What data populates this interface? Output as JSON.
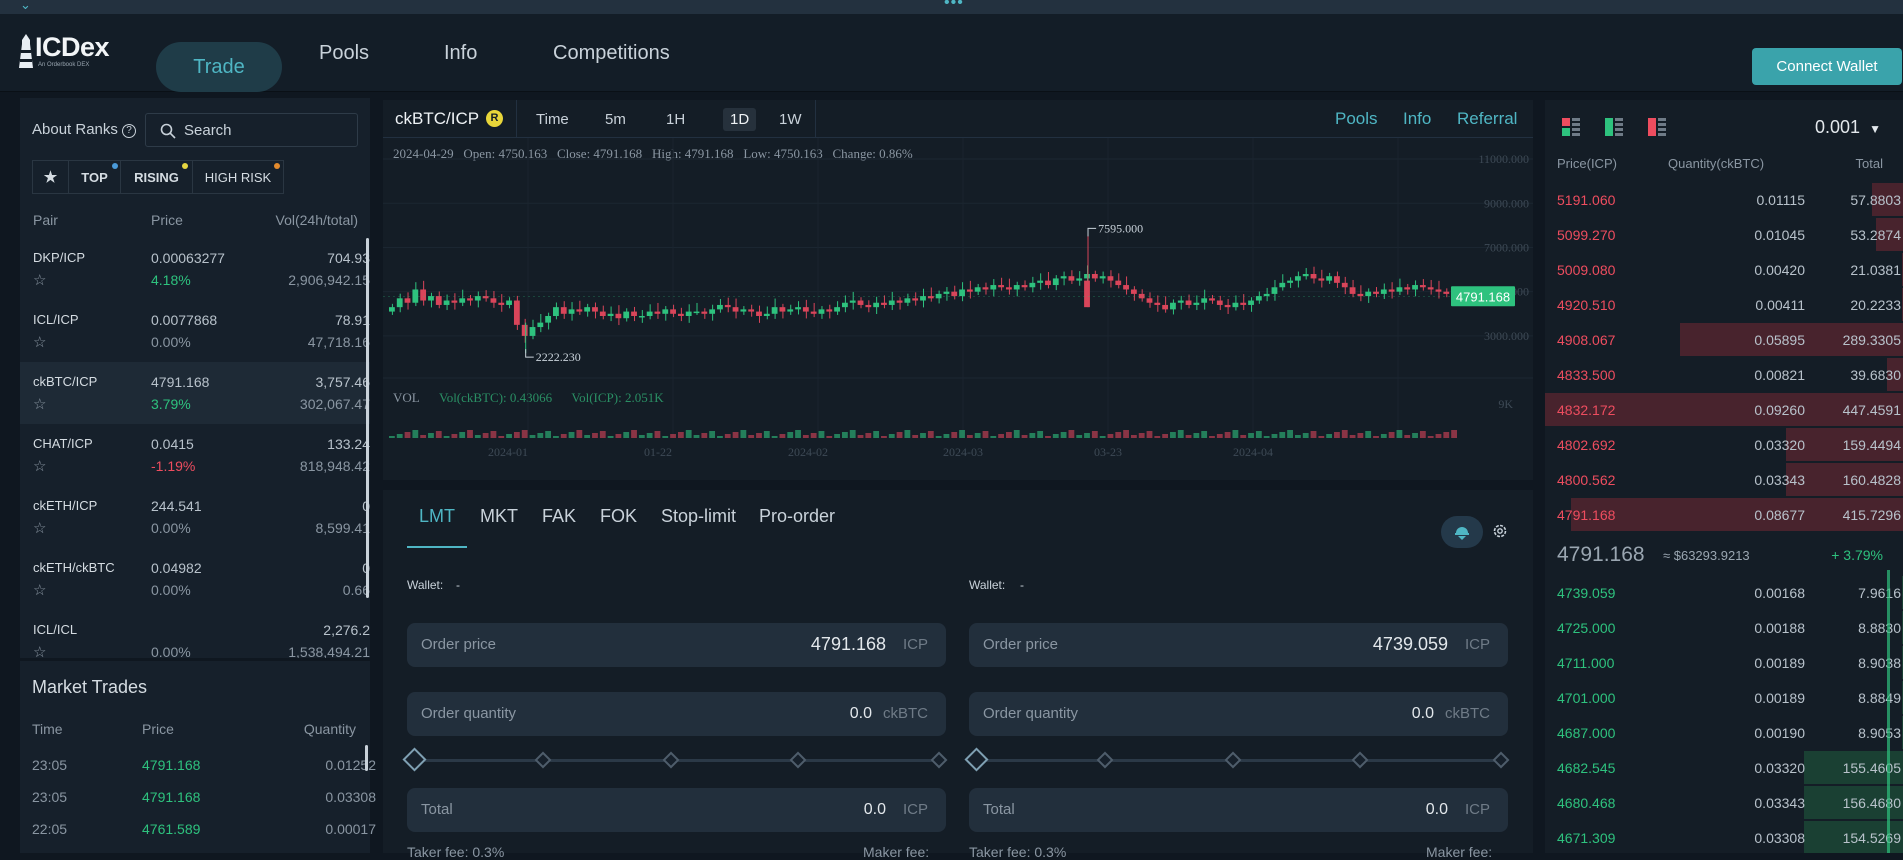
{
  "nav": {
    "logo_text": "ICDex",
    "logo_sub": "An Orderbook DEX",
    "tabs": [
      "Trade",
      "Pools",
      "Info",
      "Competitions"
    ],
    "connect_wallet": "Connect Wallet"
  },
  "sidebar": {
    "about_ranks": "About Ranks",
    "search_placeholder": "Search",
    "filters": [
      "TOP",
      "RISING",
      "HIGH RISK"
    ],
    "headers": {
      "pair": "Pair",
      "price": "Price",
      "vol": "Vol(24h/total)"
    },
    "pairs": [
      {
        "name": "DKP/ICP",
        "price": "0.00063277",
        "change": "4.18%",
        "vol": "704.93",
        "total": "2,906,942.15"
      },
      {
        "name": "ICL/ICP",
        "price": "0.0077868",
        "change": "0.00%",
        "vol": "78.91",
        "total": "47,718.16"
      },
      {
        "name": "ckBTC/ICP",
        "price": "4791.168",
        "change": "3.79%",
        "vol": "3,757.46",
        "total": "302,067.47"
      },
      {
        "name": "CHAT/ICP",
        "price": "0.0415",
        "change": "-1.19%",
        "vol": "133.24",
        "total": "818,948.42"
      },
      {
        "name": "ckETH/ICP",
        "price": "244.541",
        "change": "0.00%",
        "vol": "0",
        "total": "8,599.41"
      },
      {
        "name": "ckETH/ckBTC",
        "price": "0.04982",
        "change": "0.00%",
        "vol": "0",
        "total": "0.66"
      },
      {
        "name": "ICL/ICL",
        "price": "",
        "change": "0.00%",
        "vol": "2,276.2",
        "total": "1,538,494.21"
      }
    ]
  },
  "market_trades": {
    "title": "Market Trades",
    "headers": {
      "time": "Time",
      "price": "Price",
      "qty": "Quantity"
    },
    "rows": [
      {
        "time": "23:05",
        "price": "4791.168",
        "qty": "0.01252"
      },
      {
        "time": "23:05",
        "price": "4791.168",
        "qty": "0.03308"
      },
      {
        "time": "22:05",
        "price": "4761.589",
        "qty": "0.00017"
      }
    ]
  },
  "chart_header": {
    "pair": "ckBTC/ICP",
    "intervals": [
      "Time",
      "5m",
      "1H",
      "1D",
      "1W"
    ],
    "active_interval": "1D",
    "links": [
      "Pools",
      "Info",
      "Referral"
    ]
  },
  "chart_info": {
    "date": "2024-04-29",
    "open": "Open: 4750.163",
    "close": "Close: 4791.168",
    "high": "High: 4791.168",
    "low": "Low: 4750.163",
    "change": "Change: 0.86%",
    "vol_label": "VOL",
    "vol_btc": "Vol(ckBTC): 0.43066",
    "vol_icp": "Vol(ICP): 2.051K",
    "last_price": "4791.168",
    "max_label": "7595.000",
    "min_label": "2222.230"
  },
  "chart_data": {
    "type": "candlestick",
    "y_ticks": [
      "11000.000",
      "9000.000",
      "7000.000",
      "5000.000",
      "3000.000"
    ],
    "vol_tick": "9K",
    "x_ticks": [
      "2024-01",
      "01-22",
      "2024-02",
      "2024-03",
      "03-23",
      "2024-04"
    ],
    "ylim": [
      2000,
      11500
    ],
    "close_series": [
      4300,
      4700,
      4500,
      5100,
      4600,
      4800,
      4400,
      4600,
      4500,
      4700,
      4600,
      4800,
      4700,
      4500,
      4400,
      4600,
      3500,
      3000,
      3400,
      3600,
      3900,
      4300,
      4000,
      4200,
      4100,
      4300,
      4100,
      3900,
      4000,
      3800,
      4100,
      3900,
      3900,
      4100,
      4000,
      4200,
      4000,
      3900,
      4100,
      4100,
      4000,
      4200,
      4400,
      4300,
      4100,
      4200,
      4100,
      3900,
      4000,
      4300,
      4100,
      4200,
      4300,
      4100,
      4000,
      4200,
      4100,
      4300,
      4500,
      4600,
      4400,
      4300,
      4500,
      4400,
      4600,
      4500,
      4700,
      4600,
      4800,
      4700,
      4900,
      5000,
      4800,
      5100,
      5000,
      5200,
      5100,
      5300,
      5200,
      5100,
      5300,
      5200,
      5400,
      5500,
      5300,
      5600,
      5700,
      5500,
      5600,
      5800,
      5600,
      5700,
      5500,
      5300,
      5100,
      4900,
      4700,
      4500,
      4400,
      4200,
      4500,
      4600,
      4400,
      4500,
      4700,
      4600,
      4400,
      4300,
      4500,
      4400,
      4600,
      4800,
      4900,
      5200,
      5400,
      5500,
      5700,
      5800,
      5600,
      5500,
      5700,
      5400,
      5200,
      4900,
      4800,
      5000,
      4900,
      5100,
      5000,
      5200,
      5100,
      5300,
      5200,
      5100,
      5000,
      4900,
      4791
    ],
    "spike": {
      "value": 7595.0
    },
    "low_point": {
      "value": 2222.23
    },
    "last": 4791.168
  },
  "order_form": {
    "types": [
      "LMT",
      "MKT",
      "FAK",
      "FOK",
      "Stop-limit",
      "Pro-order"
    ],
    "wallet_label": "Wallet:",
    "wallet_value": "-",
    "buy": {
      "order_price_label": "Order price",
      "order_price": "4791.168",
      "price_unit": "ICP",
      "qty_label": "Order quantity",
      "qty": "0.0",
      "qty_unit": "ckBTC",
      "total_label": "Total",
      "total": "0.0",
      "total_unit": "ICP",
      "taker": "Taker fee: 0.3%",
      "maker": "Maker fee:"
    },
    "sell": {
      "order_price_label": "Order price",
      "order_price": "4739.059",
      "price_unit": "ICP",
      "qty_label": "Order quantity",
      "qty": "0.0",
      "qty_unit": "ckBTC",
      "total_label": "Total",
      "total": "0.0",
      "total_unit": "ICP",
      "taker": "Taker fee: 0.3%",
      "maker": "Maker fee:"
    }
  },
  "orderbook": {
    "precision": "0.001",
    "headers": {
      "price": "Price(ICP)",
      "qty": "Quantity(ckBTC)",
      "total": "Total"
    },
    "asks": [
      {
        "price": "5191.060",
        "qty": "0.01115",
        "total": "57.8803",
        "depth": 0.13
      },
      {
        "price": "5099.270",
        "qty": "0.01045",
        "total": "53.2874",
        "depth": 0.12
      },
      {
        "price": "5009.080",
        "qty": "0.00420",
        "total": "21.0381",
        "depth": 0.05
      },
      {
        "price": "4920.510",
        "qty": "0.00411",
        "total": "20.2233",
        "depth": 0.05
      },
      {
        "price": "4908.067",
        "qty": "0.05895",
        "total": "289.3305",
        "depth": 0.64
      },
      {
        "price": "4833.500",
        "qty": "0.00821",
        "total": "39.6830",
        "depth": 0.09
      },
      {
        "price": "4832.172",
        "qty": "0.09260",
        "total": "447.4591",
        "depth": 1.0
      },
      {
        "price": "4802.692",
        "qty": "0.03320",
        "total": "159.4494",
        "depth": 0.36
      },
      {
        "price": "4800.562",
        "qty": "0.03343",
        "total": "160.4828",
        "depth": 0.36
      },
      {
        "price": "4791.168",
        "qty": "0.08677",
        "total": "415.7296",
        "depth": 0.93
      }
    ],
    "mid": {
      "price": "4791.168",
      "usd": "≈ $63293.9213",
      "change": "+ 3.79%"
    },
    "bids": [
      {
        "price": "4739.059",
        "qty": "0.00168",
        "total": "7.9616",
        "depth": 0.05
      },
      {
        "price": "4725.000",
        "qty": "0.00188",
        "total": "8.8830",
        "depth": 0.05
      },
      {
        "price": "4711.000",
        "qty": "0.00189",
        "total": "8.9038",
        "depth": 0.05
      },
      {
        "price": "4701.000",
        "qty": "0.00189",
        "total": "8.8849",
        "depth": 0.05
      },
      {
        "price": "4687.000",
        "qty": "0.00190",
        "total": "8.9053",
        "depth": 0.05
      },
      {
        "price": "4682.545",
        "qty": "0.03320",
        "total": "155.4605",
        "depth": 0.31
      },
      {
        "price": "4680.468",
        "qty": "0.03343",
        "total": "156.4680",
        "depth": 0.31
      },
      {
        "price": "4671.309",
        "qty": "0.03308",
        "total": "154.5269",
        "depth": 0.31
      }
    ]
  }
}
